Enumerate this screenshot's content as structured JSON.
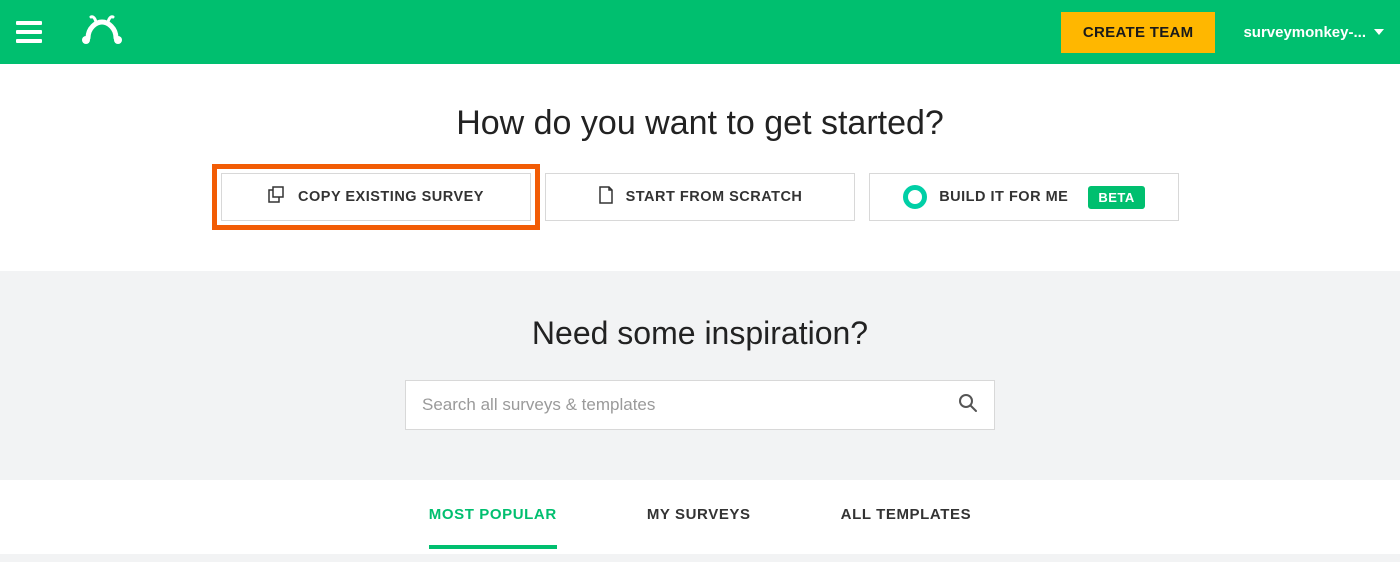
{
  "header": {
    "create_team_label": "CREATE TEAM",
    "user_label": "surveymonkey-..."
  },
  "start": {
    "title": "How do you want to get started?",
    "options": {
      "copy": "COPY EXISTING SURVEY",
      "scratch": "START FROM SCRATCH",
      "build": "BUILD IT FOR ME",
      "beta": "BETA"
    }
  },
  "inspiration": {
    "title": "Need some inspiration?",
    "search_placeholder": "Search all surveys & templates"
  },
  "tabs": {
    "popular": "MOST POPULAR",
    "my": "MY SURVEYS",
    "all": "ALL TEMPLATES"
  }
}
